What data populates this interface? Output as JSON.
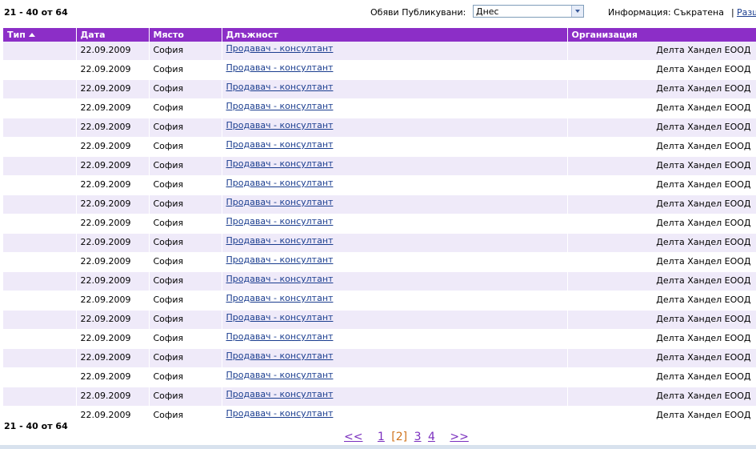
{
  "range_text": "21 - 40 от 64",
  "filter": {
    "label": "Обяви Публикувани:",
    "value": "Днес"
  },
  "info": {
    "label": "Информация: Съкратена",
    "separator": "|",
    "link": "Разширена"
  },
  "columns": {
    "type": "Тип",
    "date": "Дата",
    "place": "Място",
    "position": "Длъжност",
    "org": "Организация"
  },
  "rows": [
    {
      "date": "22.09.2009",
      "place": "София",
      "position": "Продавач - консултант",
      "org": "Делта Хандел ЕООД"
    },
    {
      "date": "22.09.2009",
      "place": "София",
      "position": "Продавач - консултант",
      "org": "Делта Хандел ЕООД"
    },
    {
      "date": "22.09.2009",
      "place": "София",
      "position": "Продавач - консултант",
      "org": "Делта Хандел ЕООД"
    },
    {
      "date": "22.09.2009",
      "place": "София",
      "position": "Продавач - консултант",
      "org": "Делта Хандел ЕООД"
    },
    {
      "date": "22.09.2009",
      "place": "София",
      "position": "Продавач - консултант",
      "org": "Делта Хандел ЕООД"
    },
    {
      "date": "22.09.2009",
      "place": "София",
      "position": "Продавач - консултант",
      "org": "Делта Хандел ЕООД"
    },
    {
      "date": "22.09.2009",
      "place": "София",
      "position": "Продавач - консултант",
      "org": "Делта Хандел ЕООД"
    },
    {
      "date": "22.09.2009",
      "place": "София",
      "position": "Продавач - консултант",
      "org": "Делта Хандел ЕООД"
    },
    {
      "date": "22.09.2009",
      "place": "София",
      "position": "Продавач - консултант",
      "org": "Делта Хандел ЕООД"
    },
    {
      "date": "22.09.2009",
      "place": "София",
      "position": "Продавач - консултант",
      "org": "Делта Хандел ЕООД"
    },
    {
      "date": "22.09.2009",
      "place": "София",
      "position": "Продавач - консултант",
      "org": "Делта Хандел ЕООД"
    },
    {
      "date": "22.09.2009",
      "place": "София",
      "position": "Продавач - консултант",
      "org": "Делта Хандел ЕООД"
    },
    {
      "date": "22.09.2009",
      "place": "София",
      "position": "Продавач - консултант",
      "org": "Делта Хандел ЕООД"
    },
    {
      "date": "22.09.2009",
      "place": "София",
      "position": "Продавач - консултант",
      "org": "Делта Хандел ЕООД"
    },
    {
      "date": "22.09.2009",
      "place": "София",
      "position": "Продавач - консултант",
      "org": "Делта Хандел ЕООД"
    },
    {
      "date": "22.09.2009",
      "place": "София",
      "position": "Продавач - консултант",
      "org": "Делта Хандел ЕООД"
    },
    {
      "date": "22.09.2009",
      "place": "София",
      "position": "Продавач - консултант",
      "org": "Делта Хандел ЕООД"
    },
    {
      "date": "22.09.2009",
      "place": "София",
      "position": "Продавач - консултант",
      "org": "Делта Хандел ЕООД"
    },
    {
      "date": "22.09.2009",
      "place": "София",
      "position": "Продавач - консултант",
      "org": "Делта Хандел ЕООД"
    },
    {
      "date": "22.09.2009",
      "place": "София",
      "position": "Продавач - консултант",
      "org": "Делта Хандел ЕООД"
    }
  ],
  "pager": {
    "prev": "<<",
    "pages": [
      "1",
      "[2]",
      "3",
      "4"
    ],
    "current_index": 1,
    "next": ">>"
  },
  "colors": {
    "header_bg": "#8c2ec7",
    "row_alt_bg": "#efeaf9",
    "link": "#1a3d8f",
    "pager_link": "#7a2fbe",
    "pager_current": "#d0741e"
  },
  "icons": {
    "sort": "sort-ascending-icon",
    "dropdown": "chevron-down-icon"
  }
}
